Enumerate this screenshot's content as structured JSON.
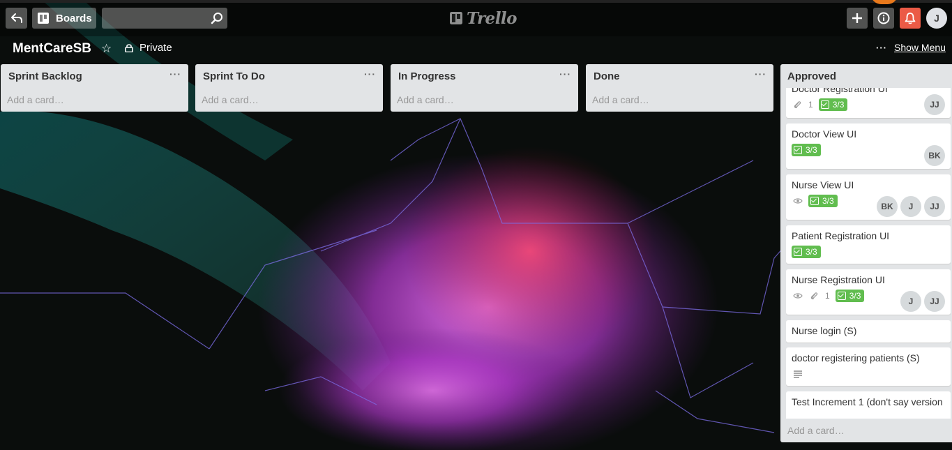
{
  "header": {
    "boards_label": "Boards",
    "search_value": "",
    "logo_text": "Trello",
    "member_initial": "J"
  },
  "board": {
    "title": "MentCareSB",
    "privacy": "Private",
    "show_menu": "Show Menu",
    "dots": "···"
  },
  "lists": [
    {
      "title": "Sprint Backlog",
      "add_card": "Add a card…",
      "menu": "···"
    },
    {
      "title": "Sprint To Do",
      "add_card": "Add a card…",
      "menu": "···"
    },
    {
      "title": "In Progress",
      "add_card": "Add a card…",
      "menu": "···"
    },
    {
      "title": "Done",
      "add_card": "Add a card…",
      "menu": "···"
    }
  ],
  "approved": {
    "title": "Approved",
    "add_card": "Add a card…",
    "cards": [
      {
        "title": "Doctor Registration UI",
        "attachments": "1",
        "checklist": "3/3",
        "members": [
          "JJ"
        ]
      },
      {
        "title": "Doctor View UI",
        "checklist": "3/3",
        "members": [
          "BK"
        ]
      },
      {
        "title": "Nurse View UI",
        "checklist": "3/3",
        "members": [
          "BK",
          "J",
          "JJ"
        ]
      },
      {
        "title": "Patient Registration UI",
        "checklist": "3/3"
      },
      {
        "title": "Nurse Registration UI",
        "attachments": "1",
        "checklist": "3/3",
        "members": [
          "J",
          "JJ"
        ]
      },
      {
        "title": "Nurse login (S)"
      },
      {
        "title": "doctor registering patients (S)"
      },
      {
        "title": "Test Increment 1 (don't say version"
      }
    ]
  },
  "icons": {
    "back": "back-arrow-icon",
    "boards": "board-icon",
    "search": "search-icon",
    "add": "plus-icon",
    "info": "info-icon",
    "notifications": "bell-icon",
    "star": "star-icon",
    "lock": "lock-icon",
    "eye": "eye-icon",
    "paperclip": "paperclip-icon",
    "description": "description-icon"
  },
  "colors": {
    "label_green": "#61bd4f",
    "notif_red": "#eb5a46",
    "list_bg": "#e2e4e6"
  }
}
